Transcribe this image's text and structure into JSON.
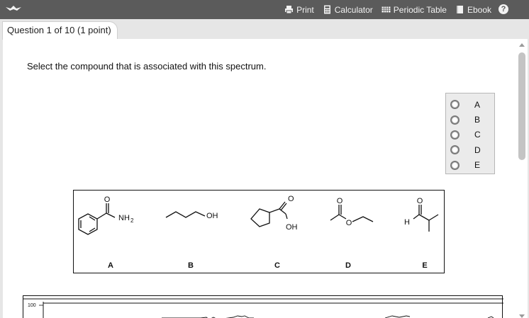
{
  "toolbar": {
    "print": "Print",
    "calculator": "Calculator",
    "periodic_table": "Periodic Table",
    "ebook": "Ebook",
    "help": "?"
  },
  "question": {
    "tab_label": "Question 1 of 10 (1 point)",
    "prompt": "Select the compound that is associated with this spectrum."
  },
  "choices": [
    "A",
    "B",
    "C",
    "D",
    "E"
  ],
  "structures": {
    "labels": [
      "A",
      "B",
      "C",
      "D",
      "E"
    ],
    "atoms": {
      "a_o": "O",
      "a_nh": "NH",
      "a_sub": "2",
      "b_oh": "OH",
      "c_o": "O",
      "c_oh": "OH",
      "d_o1": "O",
      "d_o2": "O",
      "e_o": "O",
      "e_h": "H"
    }
  },
  "spectrum": {
    "y_tick": "100"
  }
}
